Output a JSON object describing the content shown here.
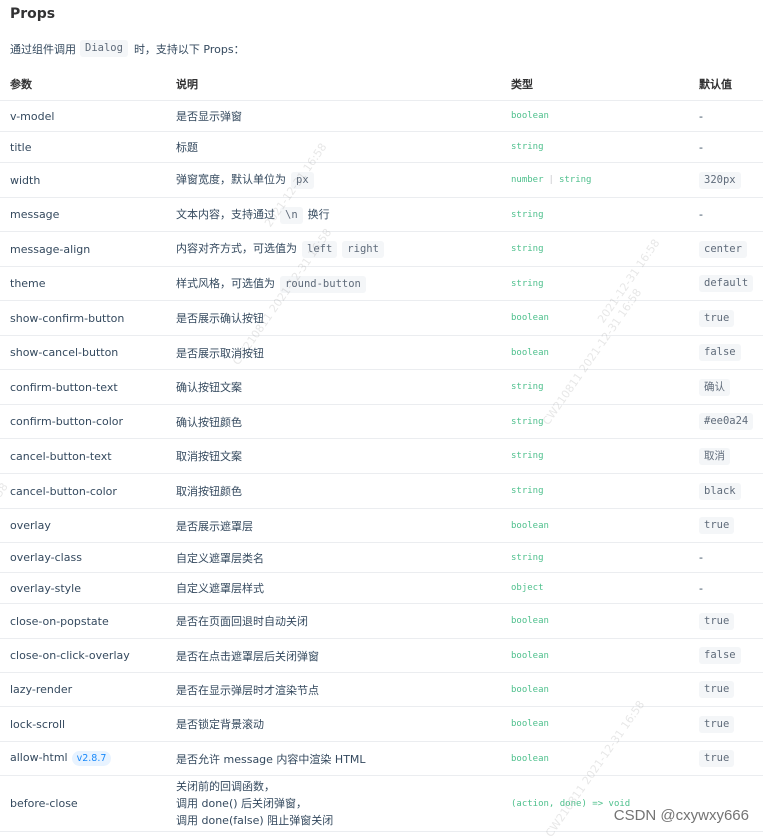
{
  "heading": "Props",
  "intro": {
    "before": "通过组件调用",
    "code": "Dialog",
    "after": "时，支持以下 Props："
  },
  "table": {
    "headers": [
      "参数",
      "说明",
      "类型",
      "默认值"
    ],
    "rows": [
      {
        "name": "v-model",
        "desc": "是否显示弹窗",
        "type": [
          "boolean"
        ],
        "default": "-",
        "default_is_code": false
      },
      {
        "name": "title",
        "desc": "标题",
        "type": [
          "string"
        ],
        "default": "-",
        "default_is_code": false
      },
      {
        "name": "width",
        "desc": "弹窗宽度，默认单位为",
        "desc_code": [
          "px"
        ],
        "type": [
          "number",
          "string"
        ],
        "default": "320px",
        "default_is_code": true
      },
      {
        "name": "message",
        "desc": "文本内容，支持通过",
        "desc_code": [
          "\\n"
        ],
        "desc_after": "换行",
        "type": [
          "string"
        ],
        "default": "-",
        "default_is_code": false
      },
      {
        "name": "message-align",
        "desc": "内容对齐方式，可选值为",
        "desc_code": [
          "left",
          "right"
        ],
        "type": [
          "string"
        ],
        "default": "center",
        "default_is_code": true
      },
      {
        "name": "theme",
        "desc": "样式风格，可选值为",
        "desc_code": [
          "round-button"
        ],
        "type": [
          "string"
        ],
        "default": "default",
        "default_is_code": true
      },
      {
        "name": "show-confirm-button",
        "desc": "是否展示确认按钮",
        "type": [
          "boolean"
        ],
        "default": "true",
        "default_is_code": true
      },
      {
        "name": "show-cancel-button",
        "desc": "是否展示取消按钮",
        "type": [
          "boolean"
        ],
        "default": "false",
        "default_is_code": true
      },
      {
        "name": "confirm-button-text",
        "desc": "确认按钮文案",
        "type": [
          "string"
        ],
        "default": "确认",
        "default_is_code": true
      },
      {
        "name": "confirm-button-color",
        "desc": "确认按钮颜色",
        "type": [
          "string"
        ],
        "default": "#ee0a24",
        "default_is_code": true
      },
      {
        "name": "cancel-button-text",
        "desc": "取消按钮文案",
        "type": [
          "string"
        ],
        "default": "取消",
        "default_is_code": true
      },
      {
        "name": "cancel-button-color",
        "desc": "取消按钮颜色",
        "type": [
          "string"
        ],
        "default": "black",
        "default_is_code": true
      },
      {
        "name": "overlay",
        "desc": "是否展示遮罩层",
        "type": [
          "boolean"
        ],
        "default": "true",
        "default_is_code": true
      },
      {
        "name": "overlay-class",
        "desc": "自定义遮罩层类名",
        "type": [
          "string"
        ],
        "default": "-",
        "default_is_code": false
      },
      {
        "name": "overlay-style",
        "desc": "自定义遮罩层样式",
        "type": [
          "object"
        ],
        "default": "-",
        "default_is_code": false
      },
      {
        "name": "close-on-popstate",
        "desc": "是否在页面回退时自动关闭",
        "type": [
          "boolean"
        ],
        "default": "true",
        "default_is_code": true
      },
      {
        "name": "close-on-click-overlay",
        "desc": "是否在点击遮罩层后关闭弹窗",
        "type": [
          "boolean"
        ],
        "default": "false",
        "default_is_code": true
      },
      {
        "name": "lazy-render",
        "desc": "是否在显示弹层时才渲染节点",
        "type": [
          "boolean"
        ],
        "default": "true",
        "default_is_code": true
      },
      {
        "name": "lock-scroll",
        "desc": "是否锁定背景滚动",
        "type": [
          "boolean"
        ],
        "default": "true",
        "default_is_code": true
      },
      {
        "name": "allow-html",
        "badge": "v2.8.7",
        "desc": "是否允许 message 内容中渲染 HTML",
        "type": [
          "boolean"
        ],
        "default": "true",
        "default_is_code": true
      },
      {
        "name": "before-close",
        "desc_lines": [
          "关闭前的回调函数，",
          "调用 done() 后关闭弹窗，",
          "调用 done(false) 阻止弹窗关闭"
        ],
        "type": [
          "(action, done) => void"
        ],
        "default": "",
        "default_is_code": false
      }
    ]
  },
  "watermarks": [
    "2021-12-31 16:58",
    "CW210811 2021-12-31 16:58",
    "CW210811 2021-12-31 16:58",
    "2021-12-31 16:58",
    "CW210811 2021-12-31 16:58",
    "58"
  ],
  "footer_watermark": "CSDN @cxywxy666",
  "colors": {
    "type_green": "#4fc08d",
    "badge_blue": "#1989fa",
    "code_bg": "#f4f6f8",
    "border": "#ebedf0"
  }
}
